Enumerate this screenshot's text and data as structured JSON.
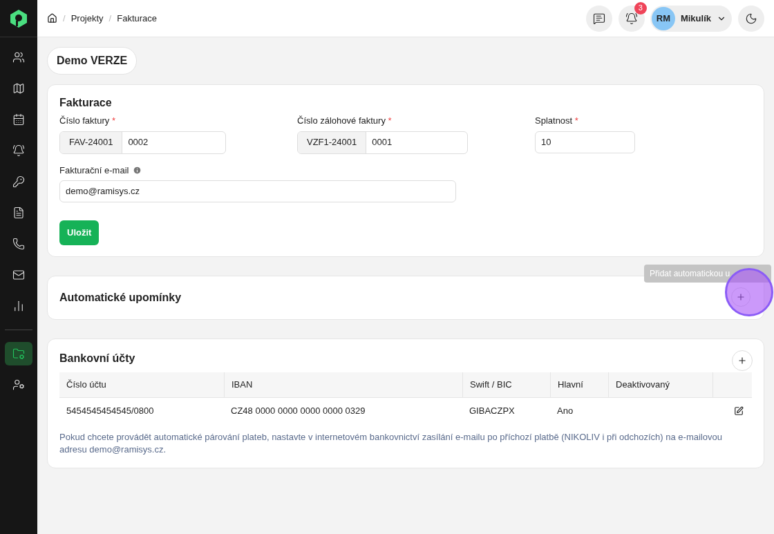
{
  "sidebar": {
    "items": [
      {
        "kind": "users",
        "selected": false
      },
      {
        "kind": "map",
        "selected": false
      },
      {
        "kind": "calendar",
        "selected": false
      },
      {
        "kind": "bell",
        "selected": false
      },
      {
        "kind": "user-key",
        "selected": false
      },
      {
        "kind": "document",
        "selected": false
      },
      {
        "kind": "phone",
        "selected": false
      },
      {
        "kind": "mail",
        "selected": false
      },
      {
        "kind": "chart",
        "selected": false
      },
      {
        "kind": "folder",
        "selected": true
      },
      {
        "kind": "user-settings",
        "selected": false
      }
    ]
  },
  "breadcrumb": {
    "separator": "/",
    "items": [
      "Projekty",
      "Fakturace"
    ]
  },
  "header": {
    "notifications": "3",
    "user": {
      "initials": "RM",
      "name": "Mikulík"
    }
  },
  "version_badge": "Demo VERZE",
  "invoicing": {
    "title": "Fakturace",
    "fields": [
      {
        "label": "Číslo faktury",
        "required_mark": "*",
        "prefix": "FAV-24001",
        "value": "0002"
      },
      {
        "label": "Číslo zálohové faktury",
        "required_mark": "*",
        "prefix": "VZF1-24001",
        "value": "0001"
      },
      {
        "label": "Splatnost",
        "required_mark": "*",
        "value": "10"
      }
    ],
    "email": {
      "label": "Fakturační e-mail",
      "value": "demo@ramisys.cz"
    },
    "save": "Uložit"
  },
  "reminders": {
    "title": "Automatické upomínky",
    "tooltip": "Přidat automatickou u"
  },
  "bank": {
    "title": "Bankovní účty",
    "columns": [
      "Číslo účtu",
      "IBAN",
      "Swift / BIC",
      "Hlavní",
      "Deaktivovaný"
    ],
    "rows": [
      [
        "5454545454545/0800",
        "CZ48 0000 0000 0000 0000 0329",
        "GIBACZPX",
        "Ano",
        ""
      ]
    ],
    "note": "Pokud chcete provádět automatické párování plateb, nastavte v internetovém bankovnictví zasílání e-mailu po příchozí platbě (NIKOLIV i při odchozích) na e-mailovou adresu demo@ramisys.cz."
  }
}
